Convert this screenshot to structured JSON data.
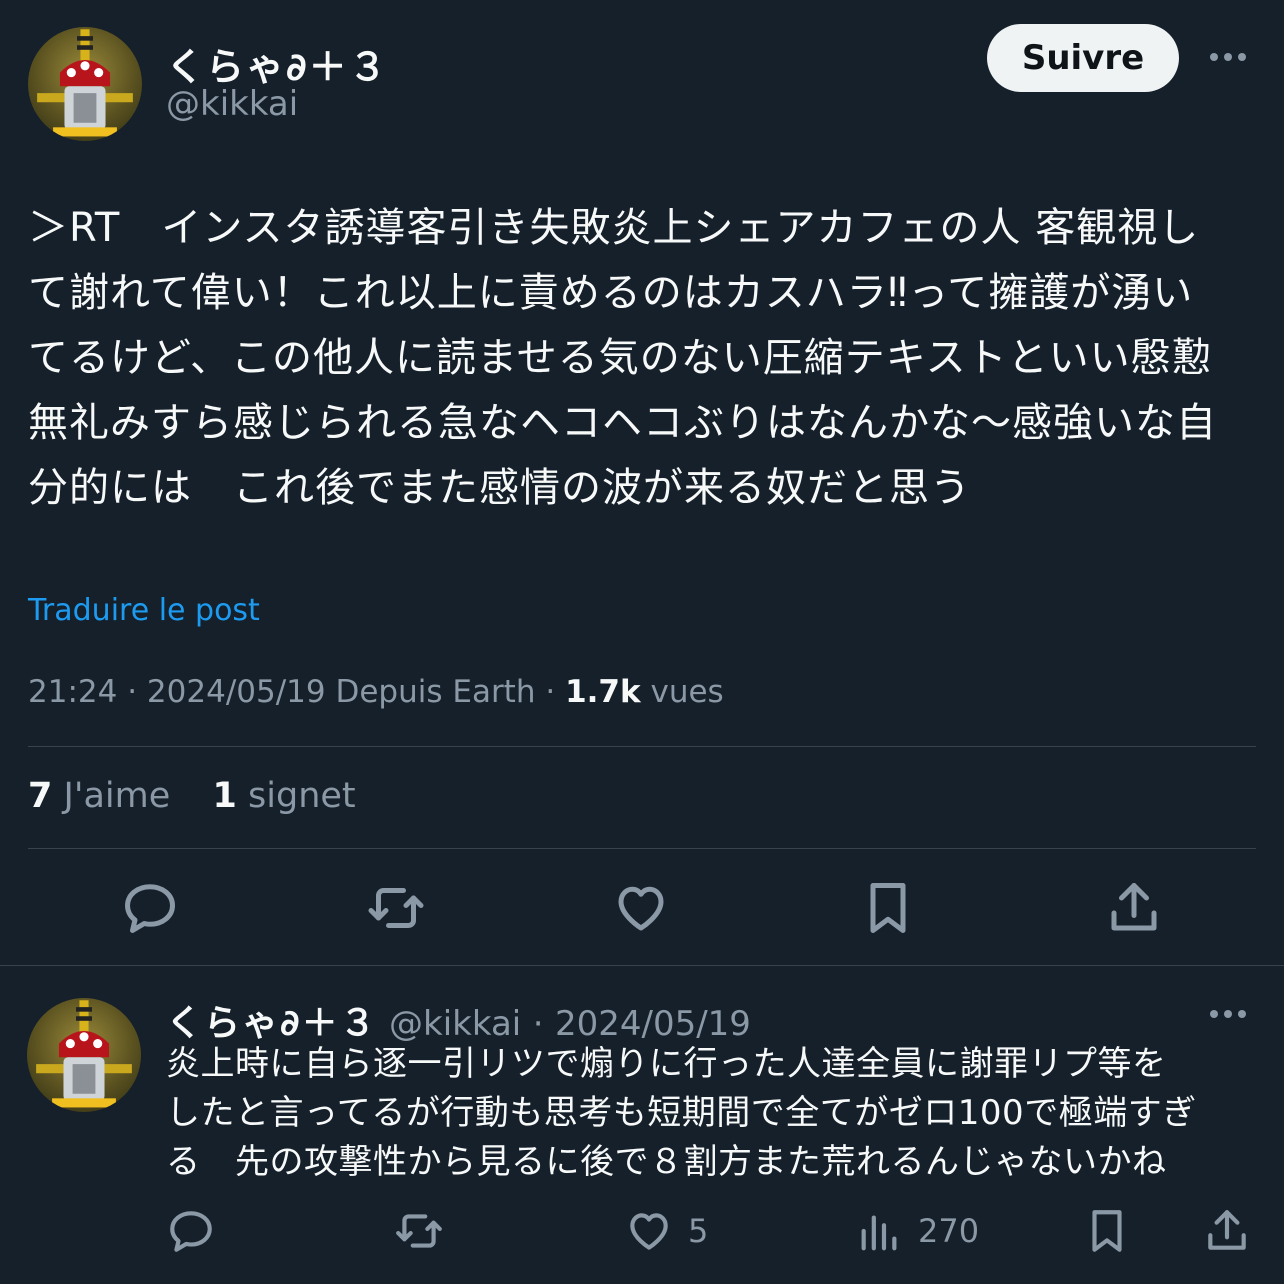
{
  "tweet": {
    "author_name": "くらゃ∂＋３",
    "author_handle": "@kikkai",
    "follow_label": "Suivre",
    "text_lines": [
      "＞RT　インスタ誘導客引き失敗炎上シェアカフェの人 客観視し",
      "て謝れて偉い！これ以上に責めるのはカスハラ‼って擁護が湧い",
      "てるけど、この他人に読ませる気のない圧縮テキストといい慇懃",
      "無礼みすら感じられる急なヘコヘコぶりはなんかな〜感強いな自",
      "分的には　これ後でまた感情の波が来る奴だと思う"
    ],
    "translate_label": "Traduire le post",
    "time": "21:24",
    "date": "2024/05/19",
    "source": "Depuis Earth",
    "views_count": "1.7k",
    "views_label": "vues",
    "likes_count": "7",
    "likes_label": "J'aime",
    "bookmarks_count": "1",
    "bookmarks_label": "signet"
  },
  "reply": {
    "author_name": "くらゃ∂＋３",
    "author_handle": "@kikkai",
    "date": "2024/05/19",
    "text_lines": [
      "炎上時に自ら逐一引リツで煽りに行った人達全員に謝罪リプ等を",
      "したと言ってるが行動も思考も短期間で全てがゼロ100で極端すぎ",
      "る　先の攻撃性から見るに後で８割方また荒れるんじゃないかね"
    ],
    "like_count": "5",
    "views_count": "270"
  },
  "icons": [
    "reply-icon",
    "retweet-icon",
    "like-icon",
    "bookmark-icon",
    "share-icon",
    "views-icon",
    "more-icon"
  ],
  "colors": {
    "background": "#15202b",
    "link": "#1d9bf0",
    "muted": "#8b98a5"
  }
}
